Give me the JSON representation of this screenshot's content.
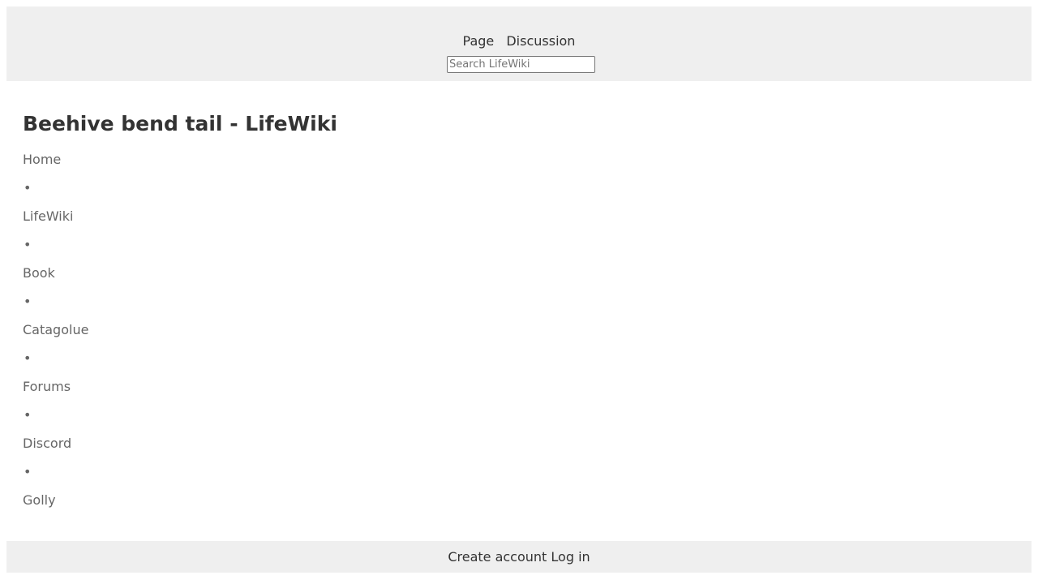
{
  "header": {
    "tabs": [
      {
        "label": "Page"
      },
      {
        "label": "Discussion"
      }
    ],
    "search": {
      "placeholder": "Search LifeWiki",
      "value": ""
    }
  },
  "main": {
    "title": "Beehive bend tail - LifeWiki",
    "nav": {
      "separator": "•",
      "items": [
        {
          "label": "Home"
        },
        {
          "label": "LifeWiki"
        },
        {
          "label": "Book"
        },
        {
          "label": "Catagolue"
        },
        {
          "label": "Forums"
        },
        {
          "label": "Discord"
        },
        {
          "label": "Golly"
        }
      ]
    }
  },
  "footer": {
    "create_account": "Create account",
    "log_in": "Log in"
  }
}
